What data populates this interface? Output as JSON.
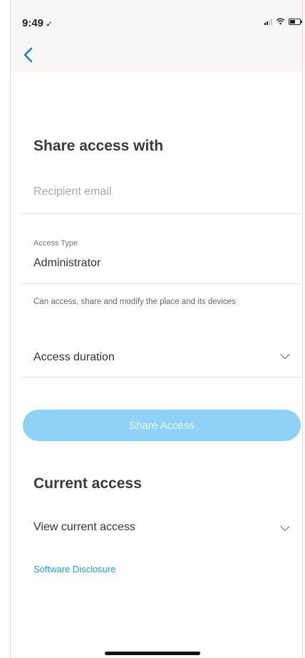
{
  "status_bar": {
    "time": "9:49",
    "location_arrow": "➶"
  },
  "share": {
    "title": "Share access with",
    "email_placeholder": "Recipient email",
    "access_type_label": "Access Type",
    "access_type_value": "Administrator",
    "access_type_hint": "Can access, share and modify the place and its devices",
    "duration_label": "Access duration",
    "button_label": "Share Access"
  },
  "current": {
    "title": "Current access",
    "view_label": "View current access"
  },
  "footer": {
    "disclosure_link": "Software Disclosure"
  },
  "colors": {
    "accent": "#1e9be0",
    "button_disabled": "#8fd2f5",
    "header_bg": "#f8f7f6"
  },
  "icons": {
    "back": "chevron-left-icon",
    "dropdown": "chevron-down-icon"
  }
}
